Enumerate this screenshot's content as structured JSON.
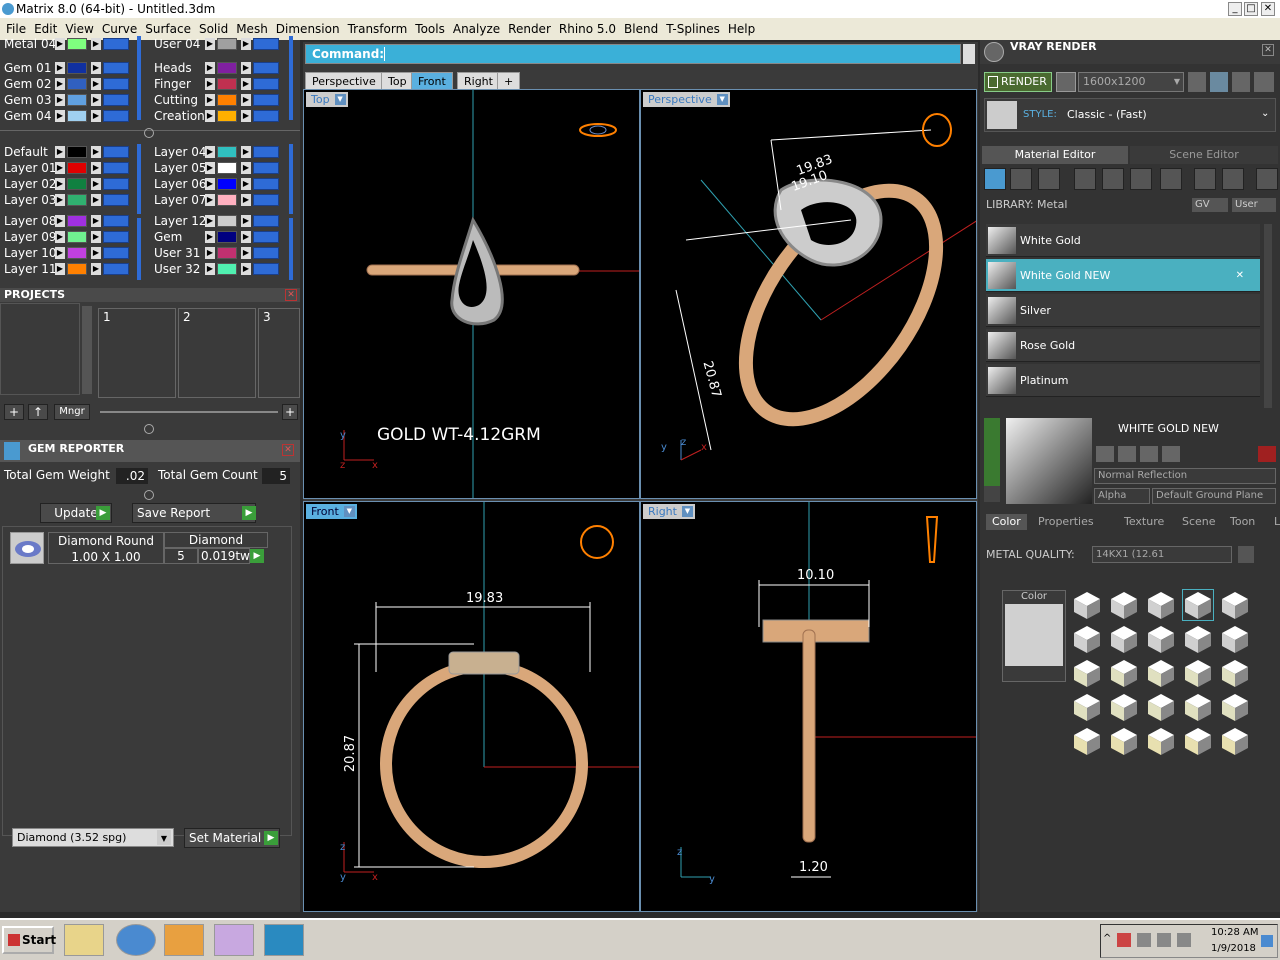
{
  "window": {
    "title": "Matrix 8.0 (64-bit) - Untitled.3dm"
  },
  "menubar": [
    "File",
    "Edit",
    "View",
    "Curve",
    "Surface",
    "Solid",
    "Mesh",
    "Dimension",
    "Transform",
    "Tools",
    "Analyze",
    "Render",
    "Rhino 5.0",
    "Blend",
    "T-Splines",
    "Help"
  ],
  "layers": {
    "top_left": [
      {
        "name": "Metal 04",
        "color": "#7fff7f"
      },
      {
        "name": "Gem 01",
        "color": "#1030a0"
      },
      {
        "name": "Gem 02",
        "color": "#3060c0"
      },
      {
        "name": "Gem 03",
        "color": "#60a0e0"
      },
      {
        "name": "Gem 04",
        "color": "#a0d0f0"
      }
    ],
    "top_right": [
      {
        "name": "User 04",
        "color": "#a0a0a0"
      },
      {
        "name": "Heads",
        "color": "#8020a0"
      },
      {
        "name": "Finger",
        "color": "#c03050"
      },
      {
        "name": "Cutting",
        "color": "#ff8000"
      },
      {
        "name": "Creation",
        "color": "#ffb000"
      }
    ],
    "mid_left": [
      {
        "name": "Default",
        "color": "#000000"
      },
      {
        "name": "Layer 01",
        "color": "#e00000"
      },
      {
        "name": "Layer 02",
        "color": "#108040"
      },
      {
        "name": "Layer 03",
        "color": "#30b070"
      },
      {
        "name": "Layer 08",
        "color": "#a030e0"
      },
      {
        "name": "Layer 09",
        "color": "#70f090"
      },
      {
        "name": "Layer 10",
        "color": "#c040e0"
      },
      {
        "name": "Layer 11",
        "color": "#ff8000"
      }
    ],
    "mid_right": [
      {
        "name": "Layer 04",
        "color": "#30c0c0"
      },
      {
        "name": "Layer 05",
        "color": "#ffffff"
      },
      {
        "name": "Layer 06",
        "color": "#0000ff"
      },
      {
        "name": "Layer 07",
        "color": "#ffb0c0"
      },
      {
        "name": "Layer 12",
        "color": "#cccccc"
      },
      {
        "name": "Gem",
        "color": "#000080"
      },
      {
        "name": "User 31",
        "color": "#c03070"
      },
      {
        "name": "User 32",
        "color": "#50f0b0"
      }
    ]
  },
  "projects": {
    "title": "PROJECTS",
    "slots": [
      "1",
      "2",
      "3"
    ],
    "mngr_label": "Mngr"
  },
  "gem_reporter": {
    "title": "GEM REPORTER",
    "total_weight_label": "Total Gem Weight",
    "total_weight": ".02",
    "total_count_label": "Total Gem Count",
    "total_count": "5",
    "update_label": "Update",
    "save_report_label": "Save Report",
    "row": {
      "type": "Diamond Round",
      "size": "1.00 X 1.00",
      "material": "Diamond",
      "count": "5",
      "weight": "0.019tw"
    },
    "material_select": "Diamond    (3.52 spg)",
    "set_material_label": "Set Material"
  },
  "command": {
    "label": "Command:",
    "value": ""
  },
  "viewport_tabs": [
    "Perspective",
    "Top",
    "Front",
    "Right",
    "+"
  ],
  "viewports": {
    "top": {
      "label": "Top",
      "annotation": "GOLD WT-4.12GRM"
    },
    "perspective": {
      "label": "Perspective",
      "dims": [
        "19.83",
        "19.10",
        "20.87"
      ]
    },
    "front": {
      "label": "Front",
      "width_dim": "19.83",
      "height_dim": "20.87"
    },
    "right": {
      "label": "Right",
      "width_dim": "10.10",
      "thickness_dim": "1.20"
    }
  },
  "vray": {
    "title": "VRAY RENDER",
    "render_label": "RENDER",
    "resolution": "1600x1200",
    "style_label": "STYLE:",
    "style_value": "Classic - (Fast)",
    "tabs": [
      "Material Editor",
      "Scene Editor"
    ],
    "library_label": "LIBRARY: Metal",
    "gv_label": "GV",
    "user_label": "User",
    "materials": [
      "White Gold",
      "White Gold NEW",
      "Silver",
      "Rose Gold",
      "Platinum"
    ],
    "selected_material": "WHITE GOLD NEW",
    "reflection": "Normal Reflection",
    "alpha_label": "Alpha",
    "ground": "Default Ground Plane",
    "sub_tabs": [
      "Color",
      "Properties",
      "Texture",
      "Scene",
      "Toon",
      "Light"
    ],
    "metal_quality_label": "METAL QUALITY:",
    "metal_quality_value": "14KX1        (12.61",
    "color_label": "Color"
  },
  "taskbar": {
    "start_label": "Start",
    "time": "10:28 AM",
    "date": "1/9/2018"
  }
}
